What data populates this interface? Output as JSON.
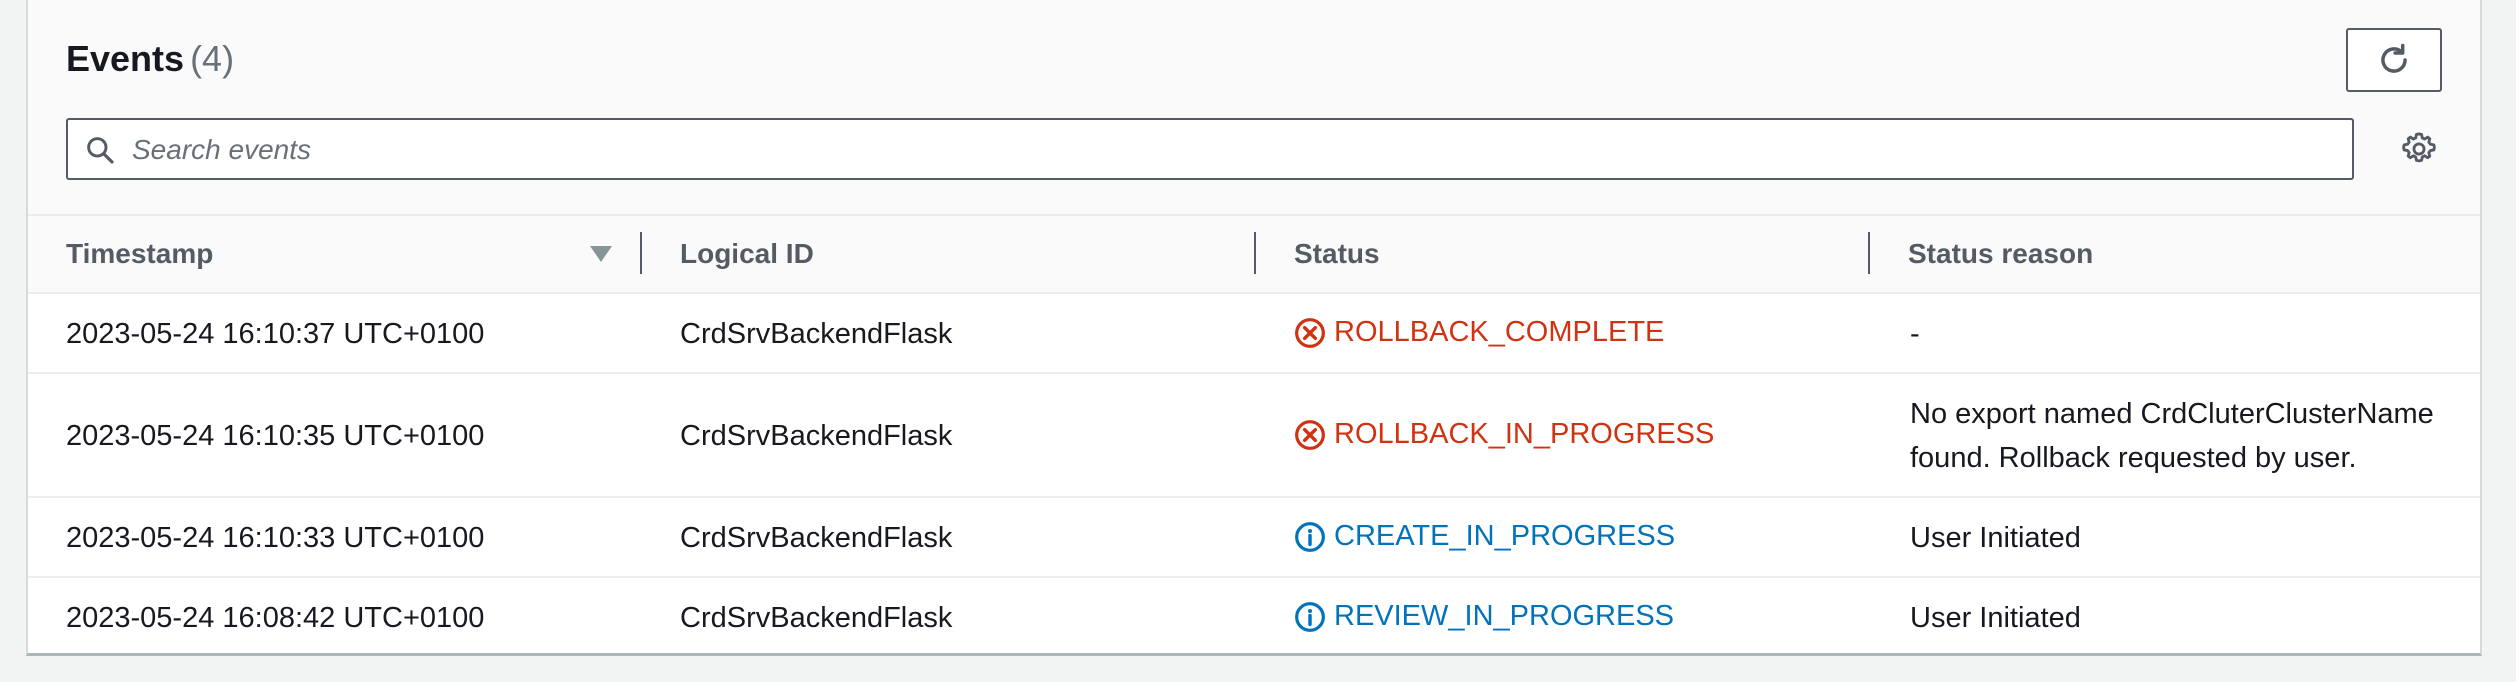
{
  "panel": {
    "title": "Events",
    "count": "(4)"
  },
  "search": {
    "placeholder": "Search events",
    "value": ""
  },
  "table": {
    "columns": [
      "Timestamp",
      "Logical ID",
      "Status",
      "Status reason"
    ],
    "sort": {
      "column": "Timestamp",
      "direction": "descending"
    },
    "rows": [
      {
        "timestamp": "2023-05-24 16:10:37 UTC+0100",
        "logical_id": "CrdSrvBackendFlask",
        "status": "ROLLBACK_COMPLETE",
        "status_type": "error",
        "status_icon": "error-icon",
        "reason": "-"
      },
      {
        "timestamp": "2023-05-24 16:10:35 UTC+0100",
        "logical_id": "CrdSrvBackendFlask",
        "status": "ROLLBACK_IN_PROGRESS",
        "status_type": "error",
        "status_icon": "error-icon",
        "reason": "No export named CrdCluterClusterName found. Rollback requested by user."
      },
      {
        "timestamp": "2023-05-24 16:10:33 UTC+0100",
        "logical_id": "CrdSrvBackendFlask",
        "status": "CREATE_IN_PROGRESS",
        "status_type": "info",
        "status_icon": "info-icon",
        "reason": "User Initiated"
      },
      {
        "timestamp": "2023-05-24 16:08:42 UTC+0100",
        "logical_id": "CrdSrvBackendFlask",
        "status": "REVIEW_IN_PROGRESS",
        "status_type": "info",
        "status_icon": "info-icon",
        "reason": "User Initiated"
      }
    ]
  },
  "colors": {
    "error": "#d13212",
    "info": "#0073bb",
    "border": "#545b64"
  },
  "icons": {
    "refresh": "refresh-icon",
    "search": "search-icon",
    "settings": "gear-icon",
    "sort": "caret-down-icon"
  }
}
